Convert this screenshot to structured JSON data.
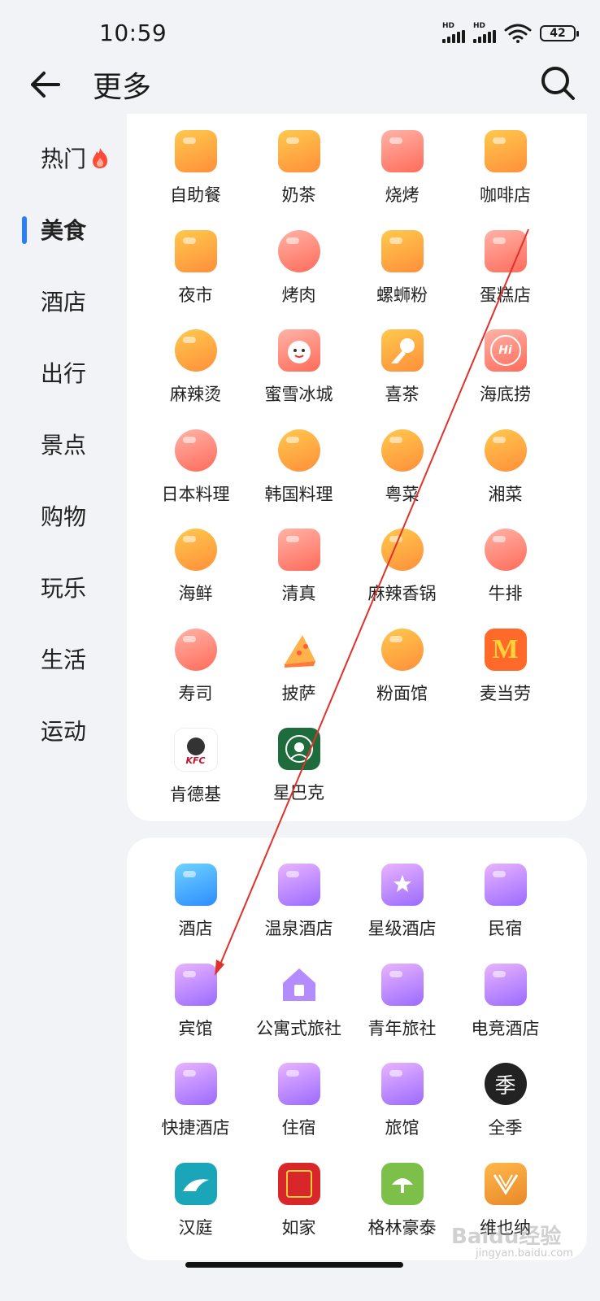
{
  "status": {
    "time": "10:59",
    "signal1": "HD",
    "signal2": "HD",
    "battery": "42"
  },
  "header": {
    "title": "更多"
  },
  "sidebar": {
    "items": [
      {
        "label": "热门"
      },
      {
        "label": "美食"
      },
      {
        "label": "酒店"
      },
      {
        "label": "出行"
      },
      {
        "label": "景点"
      },
      {
        "label": "购物"
      },
      {
        "label": "玩乐"
      },
      {
        "label": "生活"
      },
      {
        "label": "运动"
      }
    ],
    "active_index": 1
  },
  "food": {
    "items": [
      {
        "label": "自助餐",
        "icon": "dome-icon"
      },
      {
        "label": "奶茶",
        "icon": "milk-tea-icon"
      },
      {
        "label": "烧烤",
        "icon": "skewer-icon"
      },
      {
        "label": "咖啡店",
        "icon": "coffee-cup-icon"
      },
      {
        "label": "夜市",
        "icon": "food-stall-icon"
      },
      {
        "label": "烤肉",
        "icon": "meat-icon"
      },
      {
        "label": "螺蛳粉",
        "icon": "noodle-bowl-icon"
      },
      {
        "label": "蛋糕店",
        "icon": "cupcake-icon"
      },
      {
        "label": "麻辣烫",
        "icon": "spicy-bowl-icon"
      },
      {
        "label": "蜜雪冰城",
        "icon": "mixue-logo-icon"
      },
      {
        "label": "喜茶",
        "icon": "heytea-logo-icon"
      },
      {
        "label": "海底捞",
        "icon": "haidilao-logo-icon"
      },
      {
        "label": "日本料理",
        "icon": "salmon-icon"
      },
      {
        "label": "韩国料理",
        "icon": "hot-pot-icon"
      },
      {
        "label": "粤菜",
        "icon": "dumpling-icon"
      },
      {
        "label": "湘菜",
        "icon": "fish-icon"
      },
      {
        "label": "海鲜",
        "icon": "crab-icon"
      },
      {
        "label": "清真",
        "icon": "lamb-roll-icon"
      },
      {
        "label": "麻辣香锅",
        "icon": "spicy-pot-icon"
      },
      {
        "label": "牛排",
        "icon": "steak-icon"
      },
      {
        "label": "寿司",
        "icon": "sushi-icon"
      },
      {
        "label": "披萨",
        "icon": "pizza-icon"
      },
      {
        "label": "粉面馆",
        "icon": "noodle-shop-icon"
      },
      {
        "label": "麦当劳",
        "icon": "mcdonalds-logo-icon"
      },
      {
        "label": "肯德基",
        "icon": "kfc-logo-icon"
      },
      {
        "label": "星巴克",
        "icon": "starbucks-logo-icon"
      }
    ]
  },
  "hotel": {
    "items": [
      {
        "label": "酒店",
        "icon": "hotel-building-icon"
      },
      {
        "label": "温泉酒店",
        "icon": "hot-spring-icon"
      },
      {
        "label": "星级酒店",
        "icon": "star-hotel-icon"
      },
      {
        "label": "民宿",
        "icon": "guesthouse-icon"
      },
      {
        "label": "宾馆",
        "icon": "inn-icon"
      },
      {
        "label": "公寓式旅社",
        "icon": "apartment-icon"
      },
      {
        "label": "青年旅社",
        "icon": "bunk-bed-icon"
      },
      {
        "label": "电竞酒店",
        "icon": "gamepad-icon"
      },
      {
        "label": "快捷酒店",
        "icon": "bed-icon"
      },
      {
        "label": "住宿",
        "icon": "lodging-bed-icon"
      },
      {
        "label": "旅馆",
        "icon": "hostel-icon"
      },
      {
        "label": "全季",
        "icon": "ji-hotel-logo-icon"
      },
      {
        "label": "汉庭",
        "icon": "hanting-logo-icon"
      },
      {
        "label": "如家",
        "icon": "homeinn-logo-icon"
      },
      {
        "label": "格林豪泰",
        "icon": "greentree-logo-icon"
      },
      {
        "label": "维也纳",
        "icon": "vienna-logo-icon"
      }
    ]
  },
  "brand_text": {
    "kfc": "KFC",
    "mcdonalds": "M",
    "ji": "季",
    "haidilao": "Hi"
  },
  "watermark": {
    "main": "Baidu经验",
    "sub": "jingyan.baidu.com"
  },
  "colors": {
    "accent": "#2b7cff",
    "annotation": "#e0322a"
  }
}
